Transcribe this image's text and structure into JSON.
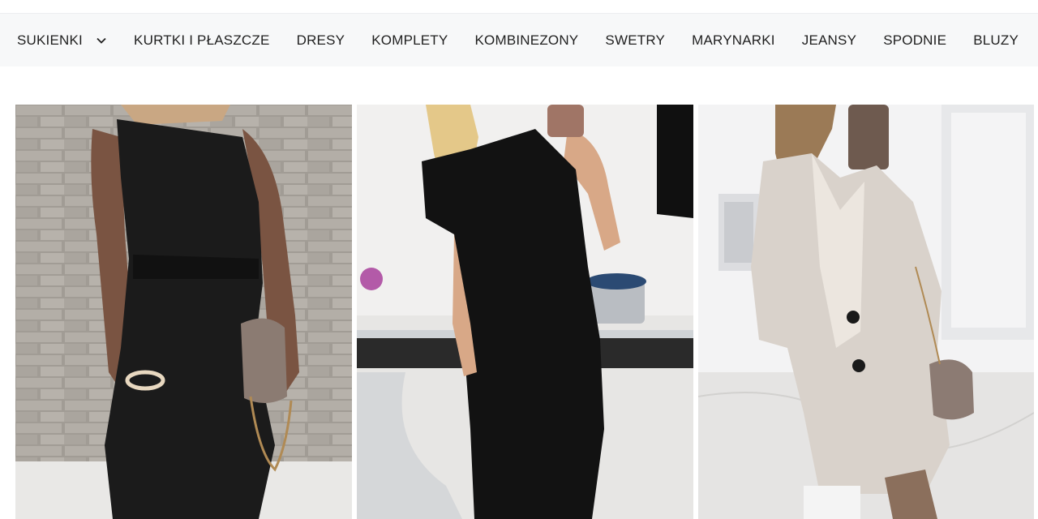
{
  "nav": {
    "items": [
      {
        "label": "SUKIENKI",
        "has_dropdown": true
      },
      {
        "label": "KURTKI I PŁASZCZE"
      },
      {
        "label": "DRESY"
      },
      {
        "label": "KOMPLETY"
      },
      {
        "label": "KOMBINEZONY"
      },
      {
        "label": "SWETRY"
      },
      {
        "label": "MARYNARKI"
      },
      {
        "label": "JEANSY"
      },
      {
        "label": "SPODNIE"
      },
      {
        "label": "BLUZY"
      }
    ],
    "dropdown_icon": "chevron-down-icon"
  },
  "products": [
    {
      "image": "black one-shoulder belted dress"
    },
    {
      "image": "black short-sleeve twisted midi dress"
    },
    {
      "image": "beige oversized coat with black buttons"
    }
  ],
  "colors": {
    "nav_background": "#f7f8f9",
    "nav_text": "#1f1f1f",
    "page_background": "#ffffff"
  }
}
